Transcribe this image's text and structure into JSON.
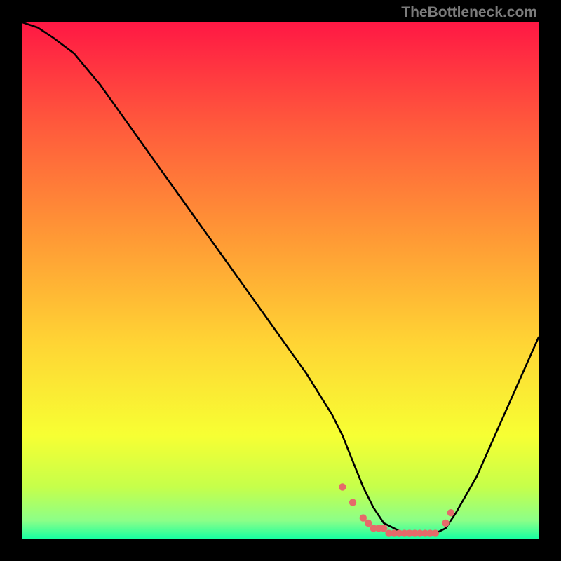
{
  "watermark": "TheBottleneck.com",
  "chart_data": {
    "type": "line",
    "title": "",
    "xlabel": "",
    "ylabel": "",
    "xlim": [
      0,
      100
    ],
    "ylim": [
      0,
      100
    ],
    "series": [
      {
        "name": "bottleneck-curve",
        "x": [
          0,
          3,
          6,
          10,
          15,
          20,
          25,
          30,
          35,
          40,
          45,
          50,
          55,
          60,
          62,
          64,
          66,
          68,
          70,
          72,
          74,
          76,
          78,
          80,
          82,
          84,
          88,
          92,
          96,
          100
        ],
        "y": [
          100,
          99,
          97,
          94,
          88,
          81,
          74,
          67,
          60,
          53,
          46,
          39,
          32,
          24,
          20,
          15,
          10,
          6,
          3,
          2,
          1,
          1,
          1,
          1,
          2,
          5,
          12,
          21,
          30,
          39
        ]
      }
    ],
    "markers": {
      "name": "bottom-markers",
      "color": "#e56a6a",
      "x": [
        62,
        64,
        66,
        67,
        68,
        69,
        70,
        71,
        72,
        73,
        74,
        75,
        76,
        77,
        78,
        79,
        80,
        82,
        83
      ],
      "y": [
        10,
        7,
        4,
        3,
        2,
        2,
        2,
        1,
        1,
        1,
        1,
        1,
        1,
        1,
        1,
        1,
        1,
        3,
        5
      ]
    },
    "gradient_stops": [
      {
        "offset": 0,
        "color": "#ff1844"
      },
      {
        "offset": 0.2,
        "color": "#ff5a3c"
      },
      {
        "offset": 0.42,
        "color": "#ff9a35"
      },
      {
        "offset": 0.62,
        "color": "#ffd434"
      },
      {
        "offset": 0.8,
        "color": "#f7ff33"
      },
      {
        "offset": 0.9,
        "color": "#c6ff4a"
      },
      {
        "offset": 0.965,
        "color": "#8cff88"
      },
      {
        "offset": 1.0,
        "color": "#19ffa0"
      }
    ]
  }
}
